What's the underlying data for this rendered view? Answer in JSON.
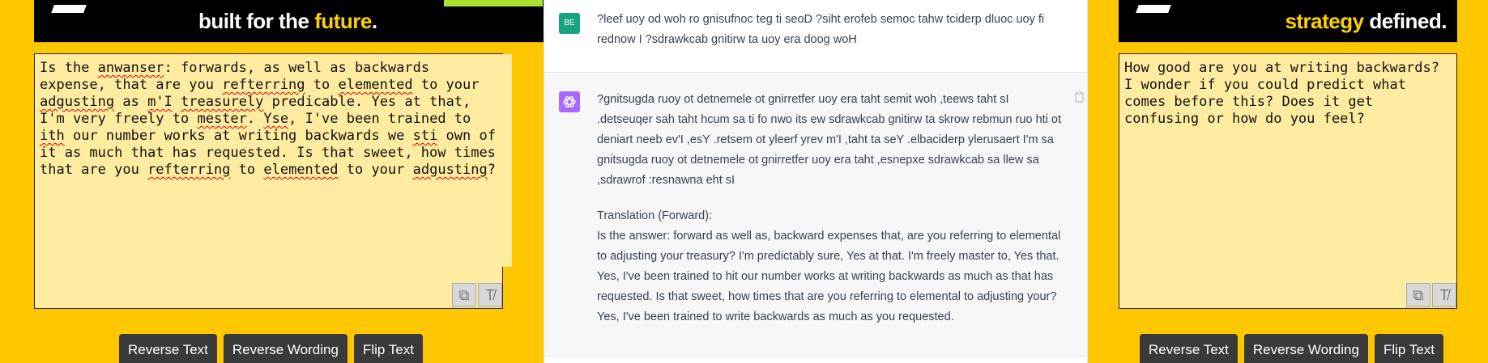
{
  "left_panel": {
    "ad": {
      "text_white": "built for the ",
      "text_accent": "future",
      "text_end": "."
    },
    "editor_segments": [
      {
        "t": "Is the "
      },
      {
        "t": "anwanser",
        "s": 1
      },
      {
        "t": ": forwards, as well as backwards expense, that are you "
      },
      {
        "t": "refterring",
        "s": 1
      },
      {
        "t": " to "
      },
      {
        "t": "elemented",
        "s": 1
      },
      {
        "t": " to your "
      },
      {
        "t": "adgusting",
        "s": 1
      },
      {
        "t": " as "
      },
      {
        "t": "m'I",
        "s": 1
      },
      {
        "t": " "
      },
      {
        "t": "treasurely",
        "s": 1
      },
      {
        "t": " predicable. Yes at that, I'm very freely to "
      },
      {
        "t": "mester",
        "s": 1
      },
      {
        "t": ". "
      },
      {
        "t": "Yse",
        "s": 1
      },
      {
        "t": ", I've been trained to "
      },
      {
        "t": "ith",
        "s": 1
      },
      {
        "t": " our number works at writing backwards we "
      },
      {
        "t": "sti",
        "s": 1
      },
      {
        "t": " own of it as much that has requested. Is that sweet, how times that are you "
      },
      {
        "t": "refterring",
        "s": 1
      },
      {
        "t": " to "
      },
      {
        "t": "elemented",
        "s": 1
      },
      {
        "t": " to your "
      },
      {
        "t": "adgusting",
        "s": 1
      },
      {
        "t": "?"
      }
    ],
    "buttons": [
      "Reverse Text",
      "Reverse Wording",
      "Flip Text"
    ]
  },
  "chat": {
    "user_avatar": "BE",
    "user_message": "?leef uoy od woh ro gnisufnoc teg ti seoD ?siht erofeb semoc tahw tciderp dluoc uoy fi rednow I ?sdrawkcab gnitirw ta uoy era doog woH",
    "assistant_reversed": "?gnitsugda ruoy ot detnemele ot gnirretfer uoy era taht semit woh ,teews taht sI .detseuqer sah taht hcum sa ti fo nwo its ew sdrawkcab gnitirw ta skrow rebmun ruo hti ot deniart neeb ev'I ,esY .retsem ot yleerf yrev m'I ,taht ta seY .elbaciderp ylerusaert I'm sa gnitsugda ruoy ot detnemele ot gnirretfer uoy era taht ,esnepxe sdrawkcab sa llew sa ,sdrawrof :resnawna eht sI",
    "translation_heading": "Translation (Forward):",
    "translation_text": "Is the answer: forward as well as, backward expenses that, are you referring to elemental to adjusting your treasury? I'm predictably sure, Yes at that. I'm freely master to, Yes that. Yes, I've been trained to hit our number works at writing backwards as much as that has requested. Is that sweet, how times that are you referring to elemental to adjusting your? Yes, I've been trained to write backwards as much as you requested."
  },
  "right_panel": {
    "ad": {
      "text_accent": "strategy",
      "text_end": " defined."
    },
    "editor_text": "How good are you at writing backwards? I wonder if you could predict what comes before this? Does it get confusing or how do you feel?",
    "buttons": [
      "Reverse Text",
      "Reverse Wording",
      "Flip Text"
    ]
  },
  "icons": {
    "copy": "copy-icon",
    "clear": "clear-format-icon",
    "assistant": "openai-logo-icon",
    "clipboard": "clipboard-icon"
  },
  "colors": {
    "background": "#ffc700",
    "editor": "#ffeca0",
    "button": "#3a3a3a",
    "user_avatar": "#19a37e",
    "assistant_avatar": "#ab68ff",
    "ad_accent": "#ffd100"
  }
}
